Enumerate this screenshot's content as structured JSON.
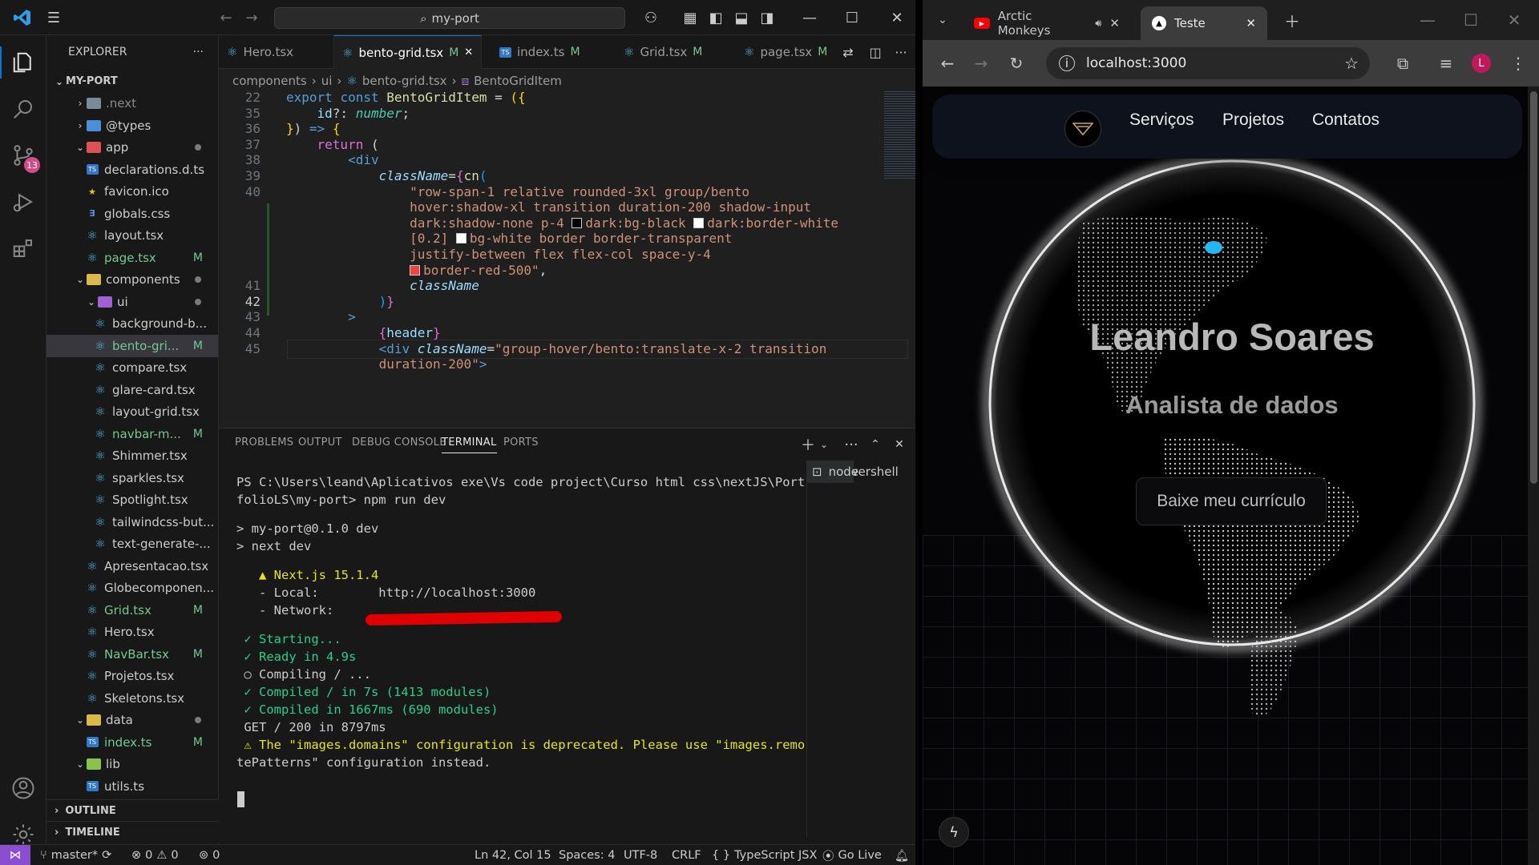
{
  "vscode": {
    "title": "my-port",
    "explorer_title": "EXPLORER",
    "scm_badge": "13",
    "tree": [
      {
        "label": "MY-PORT",
        "depth": 0,
        "type": "root",
        "open": true
      },
      {
        "label": ".next",
        "depth": 1,
        "type": "folder",
        "open": false,
        "color": "#7b8a97",
        "dim": true
      },
      {
        "label": "@types",
        "depth": 1,
        "type": "folder",
        "open": false,
        "color": "#4d8fd6"
      },
      {
        "label": "app",
        "depth": 1,
        "type": "folder",
        "open": true,
        "color": "#e05252",
        "dot": true
      },
      {
        "label": "declarations.d.ts",
        "depth": 2,
        "type": "ts"
      },
      {
        "label": "favicon.ico",
        "depth": 2,
        "type": "star"
      },
      {
        "label": "globals.css",
        "depth": 2,
        "type": "css"
      },
      {
        "label": "layout.tsx",
        "depth": 2,
        "type": "tsx"
      },
      {
        "label": "page.tsx",
        "depth": 2,
        "type": "tsx",
        "status": "M"
      },
      {
        "label": "components",
        "depth": 1,
        "type": "folder",
        "open": true,
        "color": "#d8b94a",
        "dot": true
      },
      {
        "label": "ui",
        "depth": 2,
        "type": "folder",
        "open": true,
        "color": "#a061d6",
        "dot": true
      },
      {
        "label": "background-b...",
        "depth": 3,
        "type": "tsx"
      },
      {
        "label": "bento-gri...",
        "depth": 3,
        "type": "tsx",
        "status": "M",
        "selected": true
      },
      {
        "label": "compare.tsx",
        "depth": 3,
        "type": "tsx"
      },
      {
        "label": "glare-card.tsx",
        "depth": 3,
        "type": "tsx"
      },
      {
        "label": "layout-grid.tsx",
        "depth": 3,
        "type": "tsx"
      },
      {
        "label": "navbar-m...",
        "depth": 3,
        "type": "tsx",
        "status": "M"
      },
      {
        "label": "Shimmer.tsx",
        "depth": 3,
        "type": "tsx"
      },
      {
        "label": "sparkles.tsx",
        "depth": 3,
        "type": "tsx"
      },
      {
        "label": "Spotlight.tsx",
        "depth": 3,
        "type": "tsx"
      },
      {
        "label": "tailwindcss-but...",
        "depth": 3,
        "type": "tsx"
      },
      {
        "label": "text-generate-...",
        "depth": 3,
        "type": "tsx"
      },
      {
        "label": "Apresentacao.tsx",
        "depth": 2,
        "type": "tsx"
      },
      {
        "label": "Globecomponen...",
        "depth": 2,
        "type": "tsx"
      },
      {
        "label": "Grid.tsx",
        "depth": 2,
        "type": "tsx",
        "status": "M"
      },
      {
        "label": "Hero.tsx",
        "depth": 2,
        "type": "tsx"
      },
      {
        "label": "NavBar.tsx",
        "depth": 2,
        "type": "tsx",
        "status": "M"
      },
      {
        "label": "Projetos.tsx",
        "depth": 2,
        "type": "tsx"
      },
      {
        "label": "Skeletons.tsx",
        "depth": 2,
        "type": "tsx"
      },
      {
        "label": "data",
        "depth": 1,
        "type": "folder",
        "open": true,
        "color": "#d8b94a",
        "dot": true
      },
      {
        "label": "index.ts",
        "depth": 2,
        "type": "ts",
        "status": "M"
      },
      {
        "label": "lib",
        "depth": 1,
        "type": "folder",
        "open": true,
        "color": "#8bc34a"
      },
      {
        "label": "utils.ts",
        "depth": 2,
        "type": "ts"
      }
    ],
    "outline": "OUTLINE",
    "timeline": "TIMELINE",
    "tabs": [
      {
        "label": "Hero.tsx",
        "status": "",
        "icon": "react"
      },
      {
        "label": "bento-grid.tsx",
        "status": "M",
        "icon": "react",
        "active": true
      },
      {
        "label": "index.ts",
        "status": "M",
        "icon": "ts"
      },
      {
        "label": "Grid.tsx",
        "status": "M",
        "icon": "react"
      },
      {
        "label": "page.tsx",
        "status": "M",
        "icon": "react"
      }
    ],
    "breadcrumb": [
      "components",
      "ui",
      "bento-grid.tsx",
      "BentoGridItem"
    ],
    "code": [
      {
        "n": "22",
        "segs": [
          [
            "k",
            "export "
          ],
          [
            "k",
            "const "
          ],
          [
            "f",
            "BentoGridItem"
          ],
          [
            "p",
            " = "
          ],
          [
            "y",
            "({"
          ]
        ]
      },
      {
        "n": "35",
        "segs": [
          [
            "t",
            "    id"
          ],
          [
            "p",
            "?: "
          ],
          [
            "ty it",
            "number"
          ],
          [
            "p",
            ";"
          ]
        ]
      },
      {
        "n": "36",
        "segs": [
          [
            "y",
            "}"
          ],
          [
            "p",
            ") "
          ],
          [
            "k",
            "=>"
          ],
          [
            "p",
            " "
          ],
          [
            "y",
            "{"
          ]
        ]
      },
      {
        "n": "37",
        "segs": [
          [
            "p",
            "    "
          ],
          [
            "pu",
            "return"
          ],
          [
            "p",
            " ("
          ]
        ]
      },
      {
        "n": "38",
        "segs": [
          [
            "p",
            "        "
          ],
          [
            "k",
            "<div"
          ]
        ]
      },
      {
        "n": "39",
        "segs": [
          [
            "p",
            "            "
          ],
          [
            "t it",
            "className"
          ],
          [
            "p",
            "="
          ],
          [
            "pu",
            "{"
          ],
          [
            "f",
            "cn"
          ],
          [
            "bl",
            "("
          ]
        ]
      },
      {
        "n": "40",
        "segs": [
          [
            "s",
            "                \"row-span-1 relative rounded-3xl group/bento"
          ]
        ]
      },
      {
        "n": "",
        "segs": [
          [
            "s",
            "                hover:shadow-xl transition duration-200 shadow-input"
          ]
        ]
      },
      {
        "n": "",
        "segs": [
          [
            "s",
            "                dark:shadow-none p-4 "
          ],
          [
            "sw",
            "#000000"
          ],
          [
            "s",
            "dark:bg-black "
          ],
          [
            "sw",
            "#ffffff"
          ],
          [
            "s",
            "dark:border-white"
          ]
        ]
      },
      {
        "n": "",
        "segs": [
          [
            "s",
            "                [0.2] "
          ],
          [
            "sw",
            "#ffffff"
          ],
          [
            "s",
            "bg-white border border-transparent"
          ]
        ]
      },
      {
        "n": "",
        "segs": [
          [
            "s",
            "                justify-between flex flex-col space-y-4"
          ]
        ]
      },
      {
        "n": "",
        "segs": [
          [
            "s",
            "                "
          ],
          [
            "sw",
            "#ef4444"
          ],
          [
            "s",
            "border-red-500\""
          ],
          [
            "p",
            ","
          ]
        ]
      },
      {
        "n": "41",
        "segs": [
          [
            "t it",
            "                className"
          ]
        ]
      },
      {
        "n": "42",
        "segs": [
          [
            "p",
            "            "
          ],
          [
            "bl",
            ")"
          ],
          [
            "pu",
            "}"
          ]
        ]
      },
      {
        "n": "43",
        "segs": [
          [
            "p",
            "        "
          ],
          [
            "k",
            ">"
          ]
        ]
      },
      {
        "n": "44",
        "segs": [
          [
            "p",
            "            "
          ],
          [
            "pu",
            "{"
          ],
          [
            "t",
            "header"
          ],
          [
            "pu",
            "}"
          ]
        ]
      },
      {
        "n": "45",
        "segs": [
          [
            "p",
            "            "
          ],
          [
            "k",
            "<div "
          ],
          [
            "t it",
            "className"
          ],
          [
            "p",
            "="
          ],
          [
            "s",
            "\"group-hover/bento:translate-x-2 transition"
          ]
        ]
      },
      {
        "n": "",
        "segs": [
          [
            "s",
            "            duration-200\""
          ],
          [
            "k",
            ">"
          ]
        ]
      }
    ],
    "panel_tabs": [
      "PROBLEMS",
      "OUTPUT",
      "DEBUG CONSOLE",
      "TERMINAL",
      "PORTS"
    ],
    "terminal": [
      {
        "c": "",
        "t": "PS C:\\Users\\leand\\Aplicativos exe\\Vs code project\\Curso html css\\nextJS\\Port"
      },
      {
        "c": "",
        "t": "folioLS\\my-port> npm run dev"
      },
      {
        "c": "",
        "t": ""
      },
      {
        "c": "",
        "t": "> my-port@0.1.0 dev"
      },
      {
        "c": "",
        "t": "> next dev"
      },
      {
        "c": "",
        "t": ""
      },
      {
        "c": "ylw",
        "t": "   ▲ Next.js 15.1.4"
      },
      {
        "c": "",
        "t": "   - Local:        http://localhost:3000"
      },
      {
        "c": "",
        "t": "   - Network:"
      },
      {
        "c": "",
        "t": ""
      },
      {
        "c": "grn",
        "t": " ✓ Starting..."
      },
      {
        "c": "grn",
        "t": " ✓ Ready in 4.9s"
      },
      {
        "c": "",
        "t": " ○ Compiling / ..."
      },
      {
        "c": "grn",
        "t": " ✓ Compiled / in 7s (1413 modules)"
      },
      {
        "c": "grn",
        "t": " ✓ Compiled in 1667ms (690 modules)"
      },
      {
        "c": "",
        "t": " GET / 200 in 8797ms"
      },
      {
        "c": "ylw",
        "t": " ⚠ The \"images.domains\" configuration is deprecated. Please use \"images.remo"
      },
      {
        "c": "",
        "t": "tePatterns\" configuration instead."
      }
    ],
    "terminals": [
      "node",
      "powershell"
    ],
    "status": {
      "branch": "master*",
      "errors": "0",
      "warnings": "0",
      "ports": "0",
      "position": "Ln 42, Col 15",
      "spaces": "Spaces: 4",
      "encoding": "UTF-8",
      "eol": "CRLF",
      "lang": "TypeScript JSX",
      "golive": "Go Live"
    }
  },
  "chrome": {
    "tabs": [
      {
        "label": "Arctic Monkeys"
      },
      {
        "label": "Teste",
        "active": true
      }
    ],
    "url": "localhost:3000",
    "profile": "L",
    "site": {
      "nav": [
        "Serviços",
        "Projetos",
        "Contatos"
      ],
      "name": "Leandro Soares",
      "role": "Analista de dados",
      "cta": "Baixe meu currículo"
    }
  }
}
